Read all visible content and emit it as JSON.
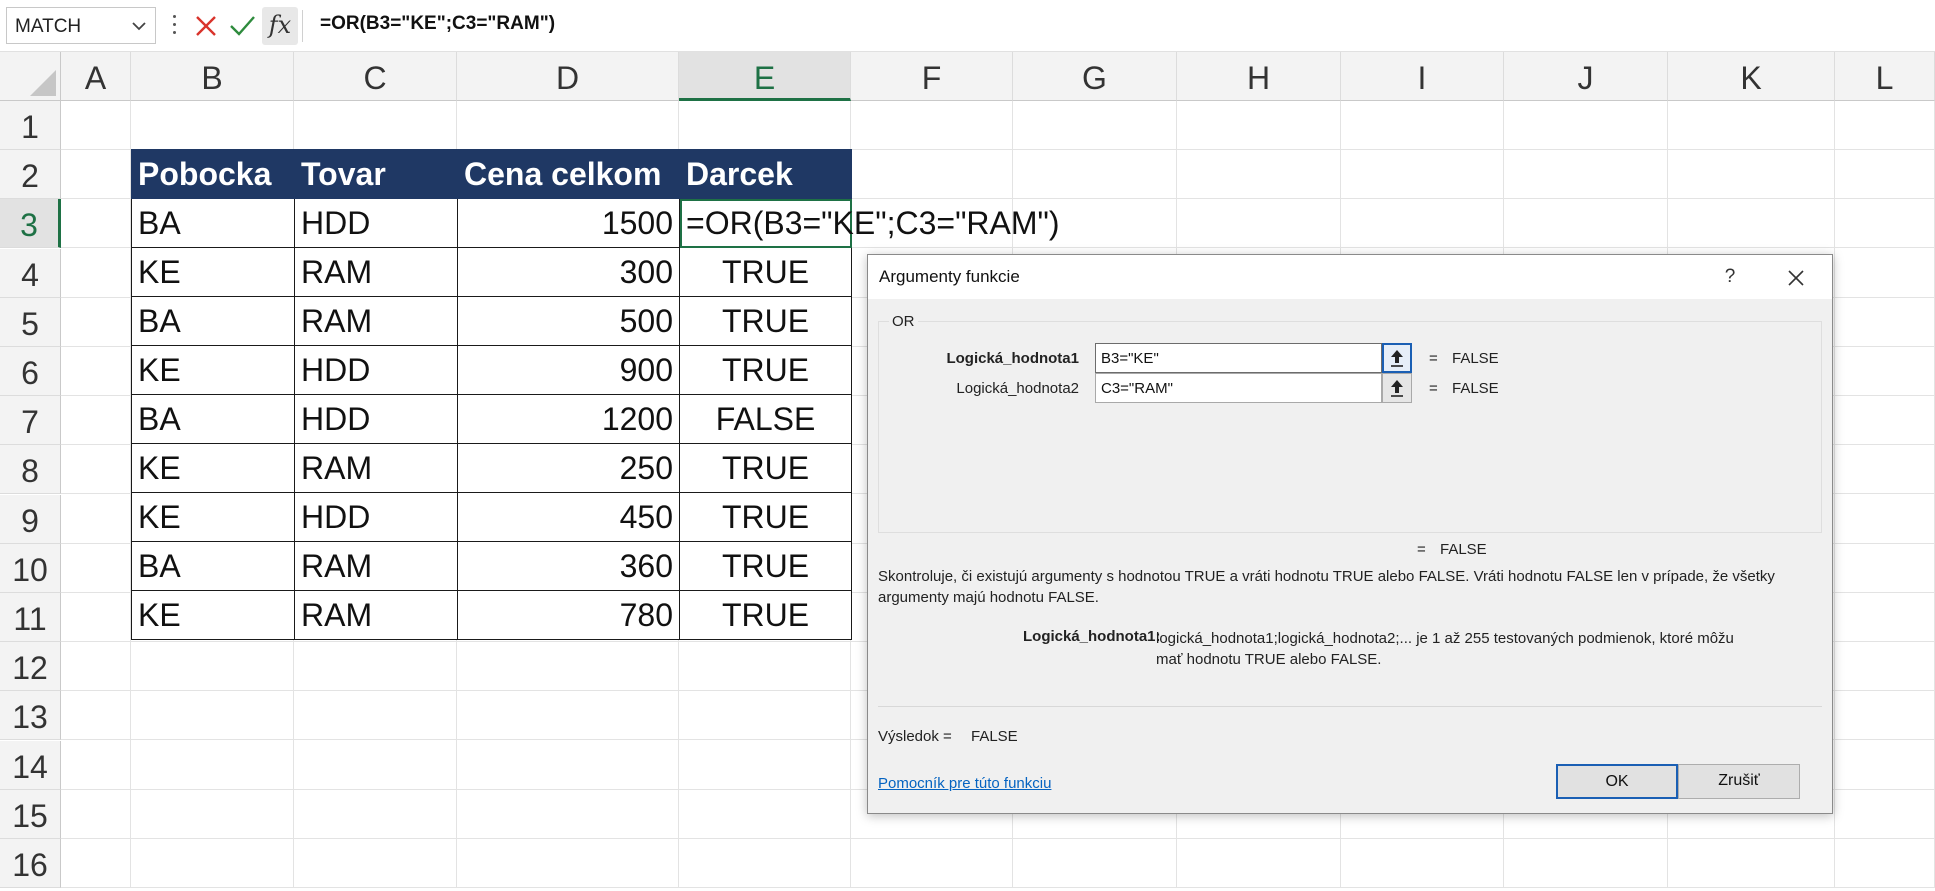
{
  "formula_bar": {
    "name_box": "MATCH",
    "fx_label": "fx",
    "formula": "=OR(B3=\"KE\";C3=\"RAM\")"
  },
  "columns": [
    "A",
    "B",
    "C",
    "D",
    "E",
    "F",
    "G",
    "H",
    "I",
    "J",
    "K",
    "L"
  ],
  "rows": [
    "1",
    "2",
    "3",
    "4",
    "5",
    "6",
    "7",
    "8",
    "9",
    "10",
    "11",
    "12",
    "13",
    "14",
    "15",
    "16"
  ],
  "table": {
    "headers": [
      "Pobocka",
      "Tovar",
      "Cena celkom",
      "Darcek"
    ],
    "rows": [
      [
        "BA",
        "HDD",
        "1500",
        ""
      ],
      [
        "KE",
        "RAM",
        "300",
        "TRUE"
      ],
      [
        "BA",
        "RAM",
        "500",
        "TRUE"
      ],
      [
        "KE",
        "HDD",
        "900",
        "TRUE"
      ],
      [
        "BA",
        "HDD",
        "1200",
        "FALSE"
      ],
      [
        "KE",
        "RAM",
        "250",
        "TRUE"
      ],
      [
        "KE",
        "HDD",
        "450",
        "TRUE"
      ],
      [
        "BA",
        "RAM",
        "360",
        "TRUE"
      ],
      [
        "KE",
        "RAM",
        "780",
        "TRUE"
      ]
    ],
    "editing_cell_text": "=OR(B3=\"KE\";C3=\"RAM\")"
  },
  "dialog": {
    "title": "Argumenty funkcie",
    "help": "?",
    "function_name": "OR",
    "args": [
      {
        "label": "Logická_hodnota1",
        "value": "B3=\"KE\"",
        "equals": "=",
        "result": "FALSE"
      },
      {
        "label": "Logická_hodnota2",
        "value": "C3=\"RAM\"",
        "equals": "=",
        "result": "FALSE"
      }
    ],
    "total_equals": "=",
    "total_result": "FALSE",
    "description": "Skontroluje, či existujú argumenty s hodnotou TRUE a vráti hodnotu TRUE alebo FALSE. Vráti hodnotu FALSE len v prípade, že všetky argumenty majú hodnotu FALSE.",
    "param_name": "Logická_hodnota1:",
    "param_desc": "logická_hodnota1;logická_hodnota2;... je 1 až 255 testovaných podmienok, ktoré môžu mať hodnotu TRUE alebo FALSE.",
    "result_label": "Výsledok =",
    "result_value": "FALSE",
    "help_link": "Pomocník pre túto funkciu",
    "ok": "OK",
    "cancel": "Zrušiť"
  }
}
